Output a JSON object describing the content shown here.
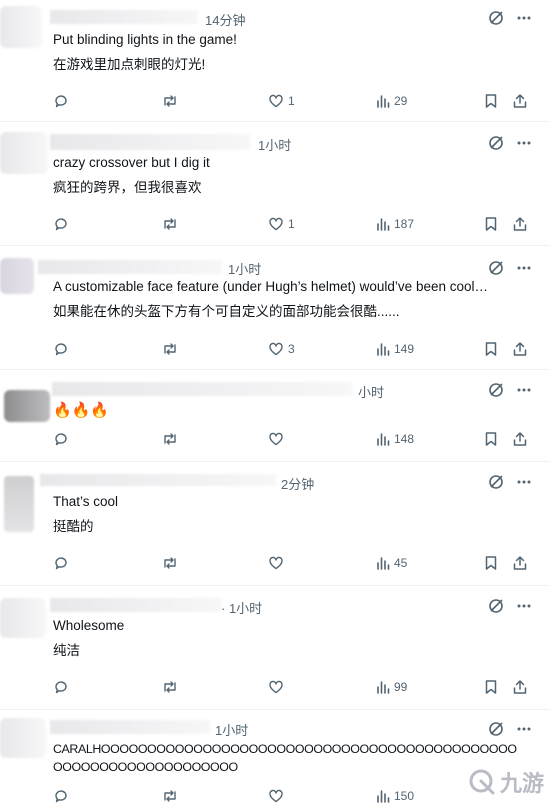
{
  "posts": [
    {
      "time": "14分钟",
      "lines": [
        "Put blinding lights in the game!",
        "在游戏里加点刺眼的灯光!"
      ],
      "likes": "1",
      "views": "29"
    },
    {
      "time": "1小时",
      "lines": [
        "crazy crossover but I dig it",
        "疯狂的跨界，但我很喜欢"
      ],
      "likes": "1",
      "views": "187"
    },
    {
      "time": "1小时",
      "lines": [
        "A customizable face feature (under Hugh’s helmet) would’ve been cool…",
        "如果能在休的头盔下方有个可自定义的面部功能会很酷......"
      ],
      "likes": "3",
      "views": "149"
    },
    {
      "time": "小时",
      "lines": [
        "🔥🔥🔥"
      ],
      "likes": "",
      "views": "148"
    },
    {
      "time": "2分钟",
      "lines": [
        "That’s cool",
        "挺酷的"
      ],
      "likes": "",
      "views": "45"
    },
    {
      "time": "· 1小时",
      "lines": [
        "Wholesome",
        "纯洁"
      ],
      "likes": "",
      "views": "99"
    },
    {
      "time": "1小时",
      "lines": [
        "CARALHOOOOOOOOOOOOOOOOOOOOOOOOOOOOOOOOOOOOOOOOOOOOO",
        "OOOOOOOOOOOOOOOOOOOO"
      ],
      "likes": "",
      "views": "150"
    }
  ],
  "watermark": {
    "text": "九游"
  },
  "colors": {
    "text": "#0f1419",
    "muted": "#536471",
    "divider": "#eff3f4"
  }
}
